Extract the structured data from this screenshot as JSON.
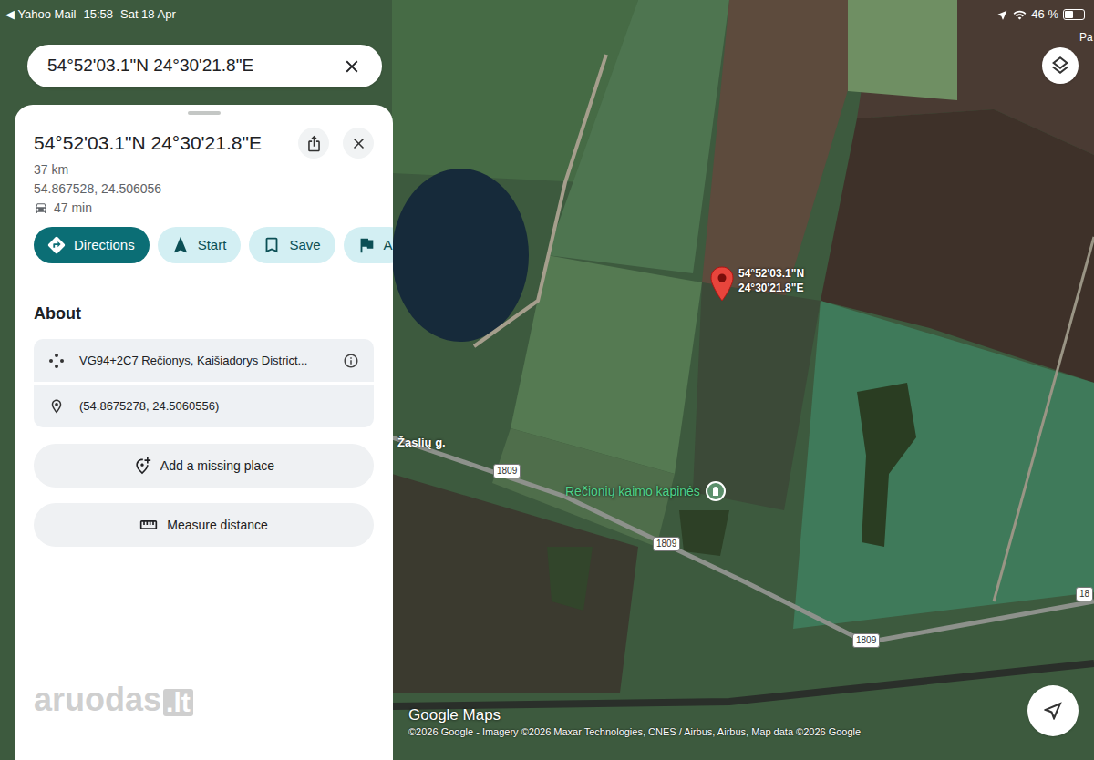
{
  "status_bar": {
    "back": "◀ Yahoo Mail",
    "time": "15:58",
    "date": "Sat 18 Apr",
    "battery": "46 %",
    "battery_level": 0.46
  },
  "search": {
    "value": "54°52'03.1\"N 24°30'21.8\"E"
  },
  "place": {
    "title": "54°52'03.1\"N 24°30'21.8\"E",
    "distance": "37 km",
    "decimal": "54.867528, 24.506056",
    "drive_time": "47 min"
  },
  "actions": [
    {
      "label": "Directions",
      "selected": true
    },
    {
      "label": "Start",
      "selected": false
    },
    {
      "label": "Save",
      "selected": false
    },
    {
      "label": "A",
      "selected": false
    }
  ],
  "about": {
    "heading": "About",
    "rows": [
      {
        "kind": "plus-code",
        "text": "VG94+2C7 Rečionys, Kaišiadorys District..."
      },
      {
        "kind": "coordinates",
        "text": "(54.8675278, 24.5060556)"
      }
    ]
  },
  "links": [
    "Add a missing place",
    "Measure distance"
  ],
  "map": {
    "pin_label_lines": [
      "54°52'03.1\"N",
      "24°30'21.8\"E"
    ],
    "street": "Žaslių g.",
    "road_shields": [
      "1809",
      "1809",
      "1809",
      "18"
    ],
    "poi": "Rečionių kaimo kapinės",
    "corner_label": "Pa",
    "watermark": "Google Maps",
    "attribution": "©2026 Google - Imagery ©2026 Maxar Technologies, CNES / Airbus, Airbus, Map data ©2026 Google"
  },
  "overlay_watermark": {
    "text": "aruodas",
    "suffix": ".lt"
  }
}
